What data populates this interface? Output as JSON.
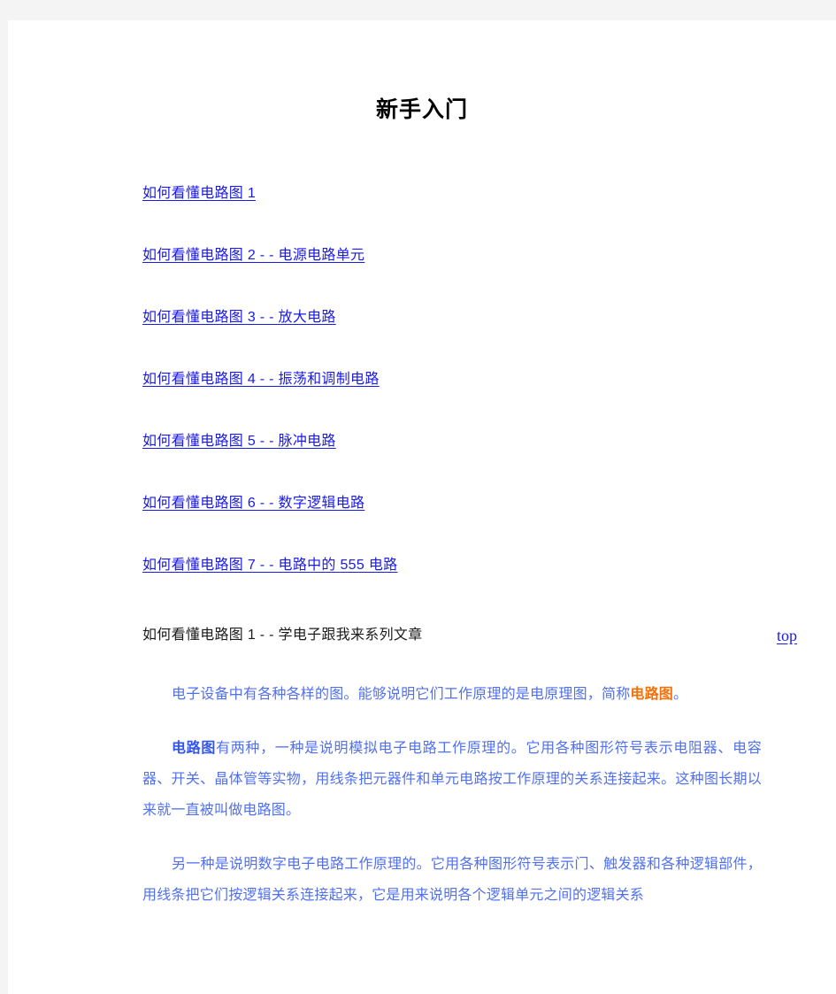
{
  "document": {
    "title": "新手入门",
    "toc": [
      {
        "label": "如何看懂电路图 1"
      },
      {
        "label": "如何看懂电路图 2 -  - 电源电路单元"
      },
      {
        "label": "如何看懂电路图 3 -  - 放大电路"
      },
      {
        "label": "如何看懂电路图 4 -  - 振荡和调制电路"
      },
      {
        "label": "如何看懂电路图 5 -  - 脉冲电路"
      },
      {
        "label": "如何看懂电路图 6 -  - 数字逻辑电路"
      },
      {
        "label": "如何看懂电路图 7 -  - 电路中的 555 电路"
      }
    ],
    "section": {
      "heading": "如何看懂电路图 1 -  - 学电子跟我来系列文章",
      "top_anchor": "top"
    },
    "paragraphs": {
      "p1": {
        "text_before": "电子设备中有各种各样的图。能够说明它们工作原理的是电原理图，简称",
        "keyword": "电路图",
        "text_after": "。"
      },
      "p2": {
        "keyword": "电路图",
        "text_after": "有两种，一种是说明模拟电子电路工作原理的。它用各种图形符号表示电阻器、电容器、开关、晶体管等实物，用线条把元器件和单元电路按工作原理的关系连接起来。这种图长期以来就一直被叫做电路图。"
      },
      "p3": {
        "text": "另一种是说明数字电子电路工作原理的。它用各种图形符号表示门、触发器和各种逻辑部件，用线条把它们按逻辑关系连接起来，它是用来说明各个逻辑单元之间的逻辑关系"
      }
    },
    "colors": {
      "page_background": "#f4f4f4",
      "sheet": "#ffffff",
      "link": "#1a1ae6",
      "body_text": "#5070f0",
      "keyword_orange": "#f4700a",
      "keyword_blue": "#3355e8",
      "heading_text": "#1a1a1a",
      "title_text": "#000000"
    }
  }
}
